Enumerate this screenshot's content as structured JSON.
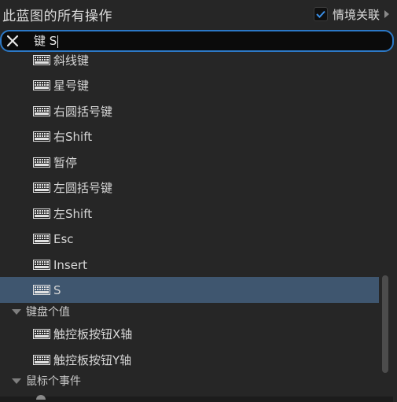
{
  "header": {
    "title": "此蓝图的所有操作",
    "context_label": "情境关联",
    "context_checked": true
  },
  "search": {
    "value": "键 S"
  },
  "list": {
    "items": [
      {
        "label": "斜线键",
        "icon": "keyboard-icon"
      },
      {
        "label": "星号键",
        "icon": "keyboard-icon"
      },
      {
        "label": "右圆括号键",
        "icon": "keyboard-icon"
      },
      {
        "label": "右Shift",
        "icon": "keyboard-icon"
      },
      {
        "label": "暂停",
        "icon": "keyboard-icon"
      },
      {
        "label": "左圆括号键",
        "icon": "keyboard-icon"
      },
      {
        "label": "左Shift",
        "icon": "keyboard-icon"
      },
      {
        "label": "Esc",
        "icon": "keyboard-icon"
      },
      {
        "label": "Insert",
        "icon": "keyboard-icon"
      },
      {
        "label": "S",
        "icon": "keyboard-icon",
        "selected": true
      }
    ],
    "categories": [
      {
        "label": "键盘个值",
        "items": [
          {
            "label": "触控板按钮X轴",
            "icon": "keyboard-icon"
          },
          {
            "label": "触控板按钮Y轴",
            "icon": "keyboard-icon"
          }
        ]
      },
      {
        "label": "鼠标个事件",
        "items": []
      }
    ]
  },
  "colors": {
    "background": "#262626",
    "selection": "#3f566f",
    "search_border": "#2c79c7",
    "checkbox_check": "#3a8ee6"
  }
}
